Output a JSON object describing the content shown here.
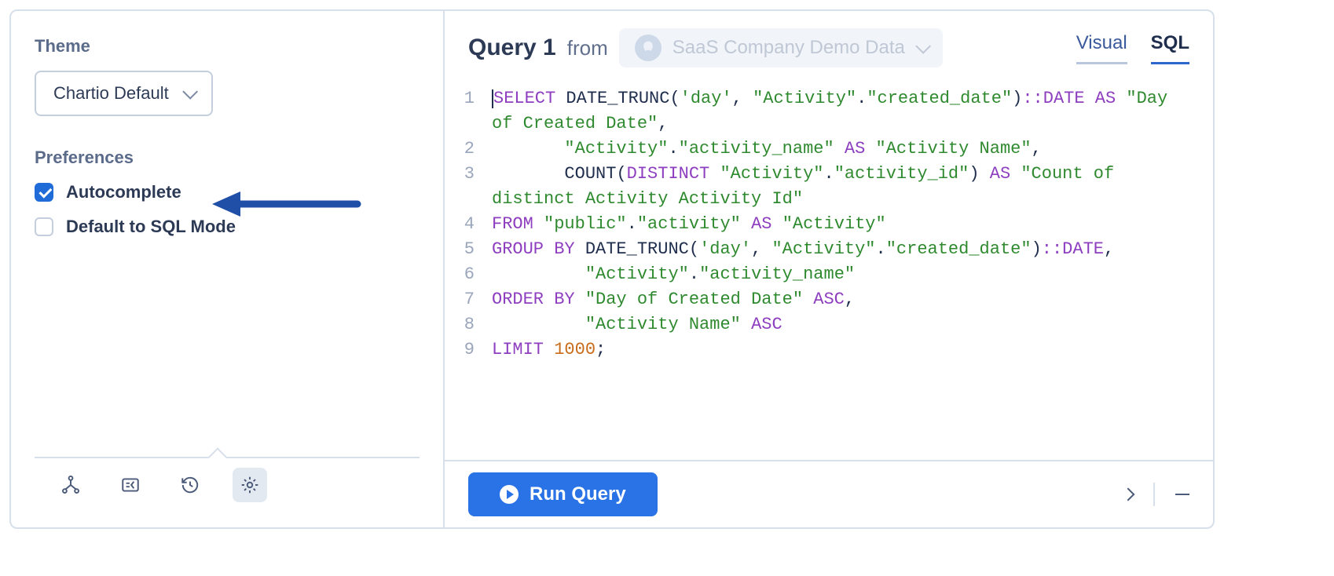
{
  "sidebar": {
    "theme_label": "Theme",
    "theme_selected": "Chartio Default",
    "preferences_label": "Preferences",
    "autocomplete_label": "Autocomplete",
    "autocomplete_checked": true,
    "default_sql_label": "Default to SQL Mode",
    "default_sql_checked": false
  },
  "header": {
    "query_title": "Query 1",
    "from_label": "from",
    "source_name": "SaaS Company Demo Data",
    "tabs": {
      "visual": "Visual",
      "sql": "SQL"
    }
  },
  "editor": {
    "line_numbers": [
      "1",
      "2",
      "3",
      "4",
      "5",
      "6",
      "7",
      "8",
      "9"
    ],
    "tokens": [
      {
        "t": "cursor"
      },
      {
        "t": "kw",
        "v": "SELECT"
      },
      {
        "t": "sp"
      },
      {
        "t": "fn",
        "v": "DATE_TRUNC"
      },
      {
        "t": "punc",
        "v": "("
      },
      {
        "t": "str",
        "v": "'day'"
      },
      {
        "t": "punc",
        "v": ", "
      },
      {
        "t": "id",
        "v": "\"Activity\""
      },
      {
        "t": "punc",
        "v": "."
      },
      {
        "t": "id",
        "v": "\"created_date\""
      },
      {
        "t": "punc",
        "v": ")"
      },
      {
        "t": "cast",
        "v": "::DATE"
      },
      {
        "t": "sp"
      },
      {
        "t": "kw",
        "v": "AS"
      },
      {
        "t": "sp"
      },
      {
        "t": "id",
        "v": "\"Day of Created Date\""
      },
      {
        "t": "punc",
        "v": ","
      },
      {
        "t": "nl"
      },
      {
        "t": "indent",
        "n": 7
      },
      {
        "t": "id",
        "v": "\"Activity\""
      },
      {
        "t": "punc",
        "v": "."
      },
      {
        "t": "id",
        "v": "\"activity_name\""
      },
      {
        "t": "sp"
      },
      {
        "t": "kw",
        "v": "AS"
      },
      {
        "t": "sp"
      },
      {
        "t": "id",
        "v": "\"Activity Name\""
      },
      {
        "t": "punc",
        "v": ","
      },
      {
        "t": "nl"
      },
      {
        "t": "indent",
        "n": 7
      },
      {
        "t": "fn",
        "v": "COUNT"
      },
      {
        "t": "punc",
        "v": "("
      },
      {
        "t": "kw",
        "v": "DISTINCT"
      },
      {
        "t": "sp"
      },
      {
        "t": "id",
        "v": "\"Activity\""
      },
      {
        "t": "punc",
        "v": "."
      },
      {
        "t": "id",
        "v": "\"activity_id\""
      },
      {
        "t": "punc",
        "v": ")"
      },
      {
        "t": "sp"
      },
      {
        "t": "kw",
        "v": "AS"
      },
      {
        "t": "sp"
      },
      {
        "t": "id",
        "v": "\"Count of distinct Activity Activity Id\""
      },
      {
        "t": "nl"
      },
      {
        "t": "kw",
        "v": "FROM"
      },
      {
        "t": "sp"
      },
      {
        "t": "id",
        "v": "\"public\""
      },
      {
        "t": "punc",
        "v": "."
      },
      {
        "t": "id",
        "v": "\"activity\""
      },
      {
        "t": "sp"
      },
      {
        "t": "kw",
        "v": "AS"
      },
      {
        "t": "sp"
      },
      {
        "t": "id",
        "v": "\"Activity\""
      },
      {
        "t": "nl"
      },
      {
        "t": "kw",
        "v": "GROUP BY"
      },
      {
        "t": "sp"
      },
      {
        "t": "fn",
        "v": "DATE_TRUNC"
      },
      {
        "t": "punc",
        "v": "("
      },
      {
        "t": "str",
        "v": "'day'"
      },
      {
        "t": "punc",
        "v": ", "
      },
      {
        "t": "id",
        "v": "\"Activity\""
      },
      {
        "t": "punc",
        "v": "."
      },
      {
        "t": "id",
        "v": "\"created_date\""
      },
      {
        "t": "punc",
        "v": ")"
      },
      {
        "t": "cast",
        "v": "::DATE"
      },
      {
        "t": "punc",
        "v": ","
      },
      {
        "t": "nl"
      },
      {
        "t": "indent",
        "n": 9
      },
      {
        "t": "id",
        "v": "\"Activity\""
      },
      {
        "t": "punc",
        "v": "."
      },
      {
        "t": "id",
        "v": "\"activity_name\""
      },
      {
        "t": "nl"
      },
      {
        "t": "kw",
        "v": "ORDER BY"
      },
      {
        "t": "sp"
      },
      {
        "t": "id",
        "v": "\"Day of Created Date\""
      },
      {
        "t": "sp"
      },
      {
        "t": "kw",
        "v": "ASC"
      },
      {
        "t": "punc",
        "v": ","
      },
      {
        "t": "nl"
      },
      {
        "t": "indent",
        "n": 9
      },
      {
        "t": "id",
        "v": "\"Activity Name\""
      },
      {
        "t": "sp"
      },
      {
        "t": "kw",
        "v": "ASC"
      },
      {
        "t": "nl"
      },
      {
        "t": "kw",
        "v": "LIMIT"
      },
      {
        "t": "sp"
      },
      {
        "t": "num",
        "v": "1000"
      },
      {
        "t": "punc",
        "v": ";"
      }
    ]
  },
  "footer": {
    "run_label": "Run Query"
  },
  "annotation": {
    "arrow_points_to": "Autocomplete",
    "arrow_color": "#1f4fa6"
  }
}
